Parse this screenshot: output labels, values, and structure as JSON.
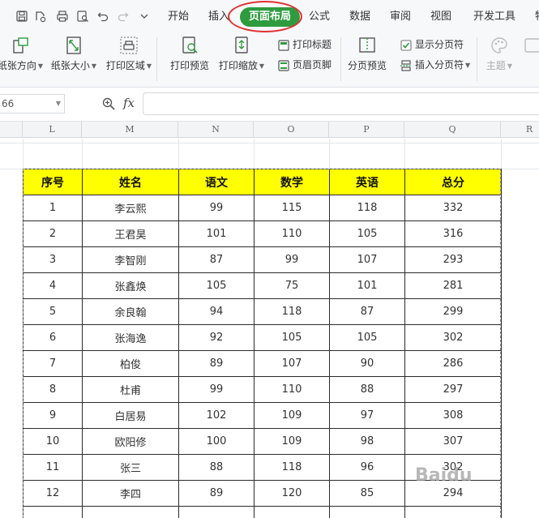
{
  "tabs": {
    "items": [
      {
        "label": "开始",
        "active": false
      },
      {
        "label": "插入",
        "active": false
      },
      {
        "label": "页面布局",
        "active": true
      },
      {
        "label": "公式",
        "active": false
      },
      {
        "label": "数据",
        "active": false
      },
      {
        "label": "审阅",
        "active": false
      },
      {
        "label": "视图",
        "active": false
      },
      {
        "label": "开发工具",
        "active": false
      },
      {
        "label": "特",
        "active": false
      }
    ]
  },
  "ribbon": {
    "orientation": "纸张方向",
    "size": "纸张大小",
    "print_area": "打印区域",
    "print_preview": "打印预览",
    "print_scale": "打印缩放",
    "print_titles": "打印标题",
    "header_footer": "页眉页脚",
    "page_break_preview": "分页预览",
    "show_page_breaks": "显示分页符",
    "insert_page_break": "插入分页符",
    "theme": "主题"
  },
  "formula_bar": {
    "name_box": "66",
    "fx": "fx",
    "formula": ""
  },
  "columns": [
    "L",
    "M",
    "N",
    "O",
    "P",
    "Q",
    "R"
  ],
  "table": {
    "headers": [
      "序号",
      "姓名",
      "语文",
      "数学",
      "英语",
      "总分"
    ],
    "rows": [
      [
        "1",
        "李云熙",
        "99",
        "115",
        "118",
        "332"
      ],
      [
        "2",
        "王君昊",
        "101",
        "110",
        "105",
        "316"
      ],
      [
        "3",
        "李智刚",
        "87",
        "99",
        "107",
        "293"
      ],
      [
        "4",
        "张鑫焕",
        "105",
        "75",
        "101",
        "281"
      ],
      [
        "5",
        "余良翰",
        "94",
        "118",
        "87",
        "299"
      ],
      [
        "6",
        "张海逸",
        "92",
        "105",
        "105",
        "302"
      ],
      [
        "7",
        "柏俊",
        "89",
        "107",
        "90",
        "286"
      ],
      [
        "8",
        "杜甫",
        "99",
        "110",
        "88",
        "297"
      ],
      [
        "9",
        "白居易",
        "102",
        "109",
        "97",
        "308"
      ],
      [
        "10",
        "欧阳修",
        "100",
        "109",
        "98",
        "307"
      ],
      [
        "11",
        "张三",
        "88",
        "118",
        "96",
        "302"
      ],
      [
        "12",
        "李四",
        "89",
        "120",
        "85",
        "294"
      ],
      [
        "",
        "",
        "",
        "",
        "",
        ""
      ]
    ]
  },
  "watermark": "Baidu"
}
